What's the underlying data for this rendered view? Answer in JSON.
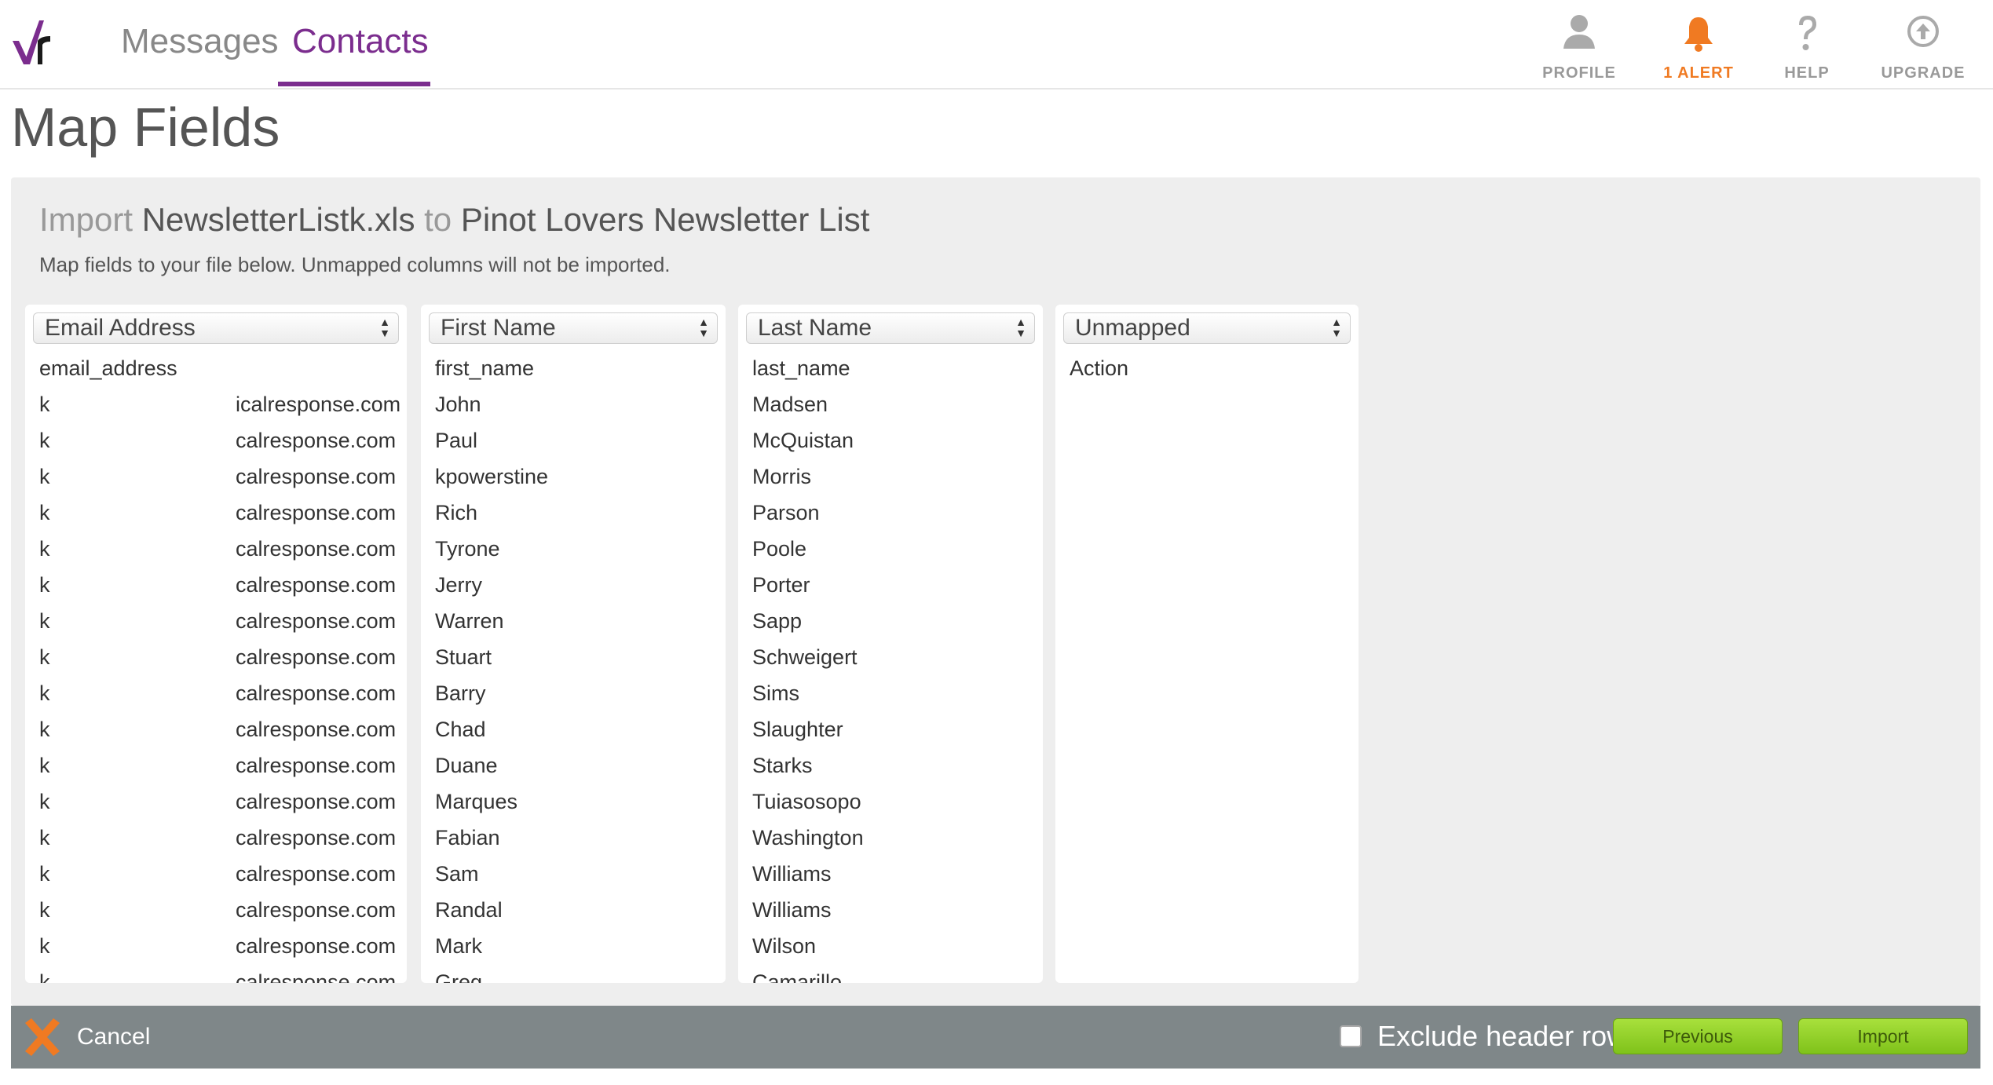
{
  "nav": {
    "tabs": [
      {
        "label": "Messages"
      },
      {
        "label": "Contacts",
        "active": true
      }
    ],
    "utilities": [
      {
        "label": "PROFILE",
        "icon": "person-icon"
      },
      {
        "label": "1 ALERT",
        "icon": "bell-icon"
      },
      {
        "label": "HELP",
        "icon": "question-icon"
      },
      {
        "label": "UPGRADE",
        "icon": "upload-arrow-icon"
      }
    ]
  },
  "page": {
    "title": "Map Fields"
  },
  "import": {
    "prefix": "Import",
    "file": "NewsletterListk.xls",
    "connector": "to",
    "list": "Pinot Lovers Newsletter List",
    "subtext": "Map fields to your file below. Unmapped columns will not be imported."
  },
  "columns": [
    {
      "mapping": "Email Address",
      "header": "email_address",
      "rows": [
        {
          "start": "k",
          "end": "icalresponse.com"
        },
        {
          "start": "k",
          "end": "calresponse.com"
        },
        {
          "start": "k",
          "end": "calresponse.com"
        },
        {
          "start": "k",
          "end": "calresponse.com"
        },
        {
          "start": "k",
          "end": "calresponse.com"
        },
        {
          "start": "k",
          "end": "calresponse.com"
        },
        {
          "start": "k",
          "end": "calresponse.com"
        },
        {
          "start": "k",
          "end": "calresponse.com"
        },
        {
          "start": "k",
          "end": "calresponse.com"
        },
        {
          "start": "k",
          "end": "calresponse.com"
        },
        {
          "start": "k",
          "end": "calresponse.com"
        },
        {
          "start": "k",
          "end": "calresponse.com"
        },
        {
          "start": "k",
          "end": "calresponse.com"
        },
        {
          "start": "k",
          "end": "calresponse.com"
        },
        {
          "start": "k",
          "end": "calresponse.com"
        },
        {
          "start": "k",
          "end": "calresponse.com"
        },
        {
          "start": "k",
          "end": "calresponse.com"
        }
      ]
    },
    {
      "mapping": "First Name",
      "header": "first_name",
      "rows": [
        "John",
        "Paul",
        "kpowerstine",
        "Rich",
        "Tyrone",
        "Jerry",
        "Warren",
        "Stuart",
        "Barry",
        "Chad",
        "Duane",
        "Marques",
        "Fabian",
        "Sam",
        "Randal",
        "Mark",
        "Greg"
      ]
    },
    {
      "mapping": "Last Name",
      "header": "last_name",
      "rows": [
        "Madsen",
        "McQuistan",
        "Morris",
        "Parson",
        "Poole",
        "Porter",
        "Sapp",
        "Schweigert",
        "Sims",
        "Slaughter",
        "Starks",
        "Tuiasosopo",
        "Washington",
        "Williams",
        "Williams",
        "Wilson",
        "Camarillo"
      ]
    },
    {
      "mapping": "Unmapped",
      "header": "Action",
      "rows": []
    }
  ],
  "footer": {
    "cancel_label": "Cancel",
    "exclude_label": "Exclude header row",
    "exclude_checked": false,
    "previous_label": "Previous",
    "import_label": "Import"
  },
  "colors": {
    "brand_purple": "#7b2d8e",
    "alert_orange": "#f07a22",
    "button_green": "#8fd12a",
    "footer_gray": "#7f8789"
  }
}
